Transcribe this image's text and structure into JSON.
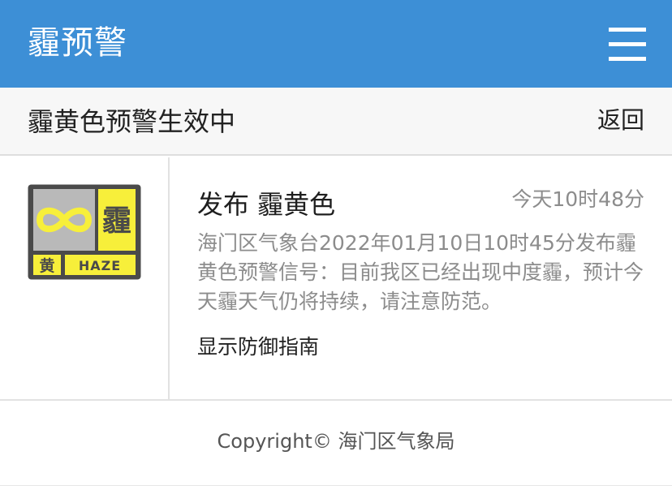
{
  "header": {
    "title": "霾预警",
    "menu_icon": "hamburger-menu-icon"
  },
  "subbar": {
    "title": "霾黄色预警生效中",
    "back_label": "返回"
  },
  "alert": {
    "icon": {
      "name": "haze-yellow-warning-icon",
      "char": "霾",
      "color_char": "黄",
      "en": "HAZE",
      "symbol": "∞"
    },
    "title": "发布 霾黄色",
    "time": "今天10时48分",
    "body": "海门区气象台2022年01月10日10时45分发布霾黄色预警信号：目前我区已经出现中度霾，预计今天霾天气仍将持续，请注意防范。",
    "guide_label": "显示防御指南"
  },
  "footer": {
    "copyright": "Copyright© 海门区气象局"
  },
  "colors": {
    "header_bg": "#3d8fd6",
    "icon_yellow": "#f7ef3a",
    "icon_gray": "#b9b9b9",
    "icon_border": "#4a4a4a",
    "muted_text": "#8c8c8c"
  }
}
